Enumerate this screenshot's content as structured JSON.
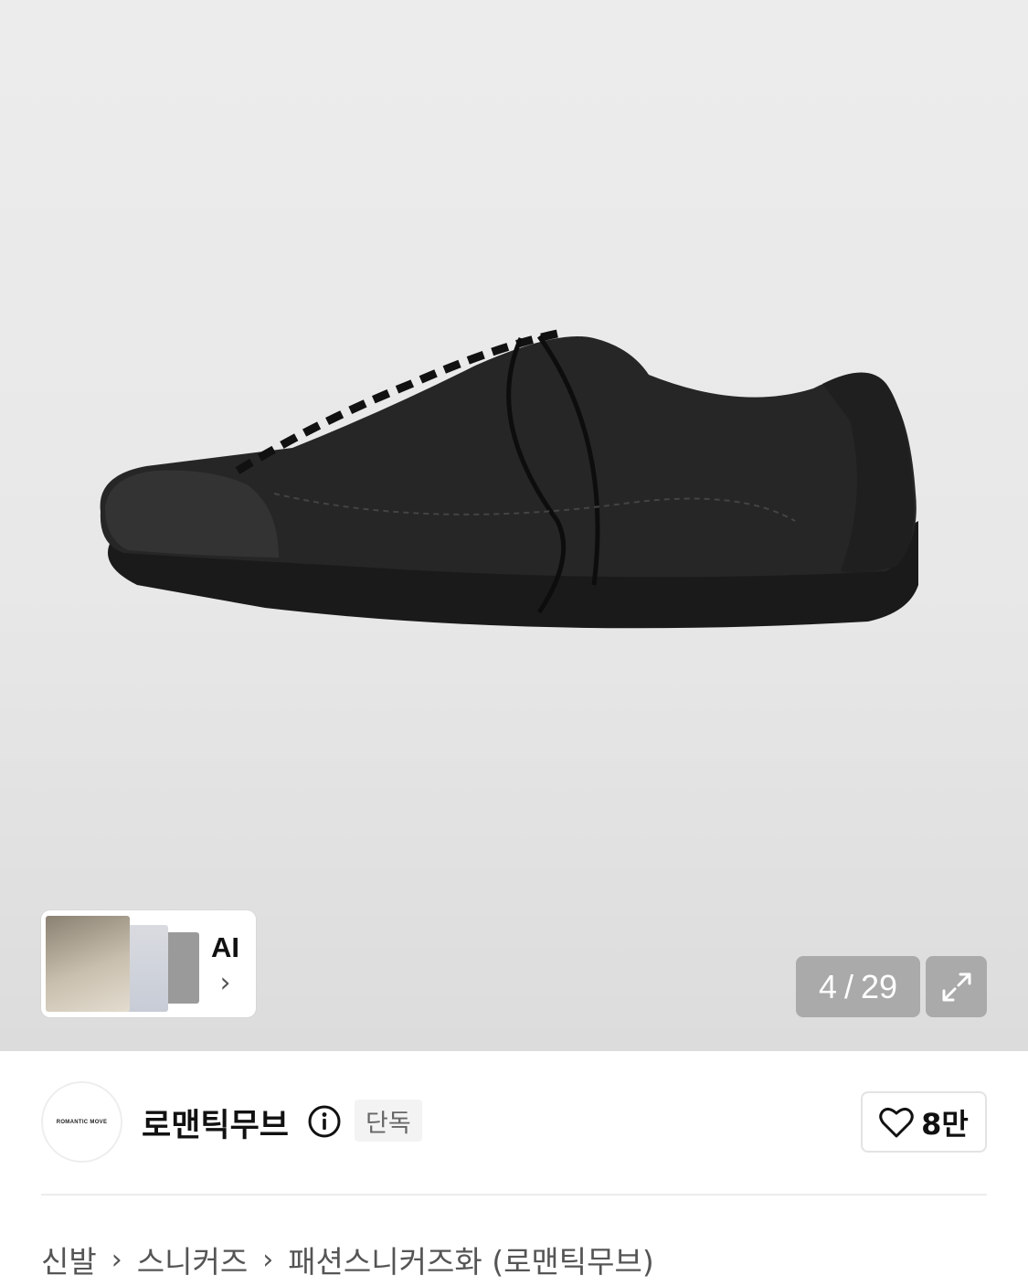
{
  "gallery": {
    "current": "4",
    "separator": "/",
    "total": "29",
    "ai_label": "AI",
    "ai_chevron": "›"
  },
  "brand": {
    "logo_text": "ROMANTIC MOVE",
    "name": "로맨틱무브",
    "badge": "단독",
    "likes": "8만"
  },
  "breadcrumb": {
    "items": [
      "신발",
      "스니커즈",
      "패션스니커즈화 (로맨틱무브)"
    ],
    "separator": "›"
  },
  "icons": {
    "info": "info-circle-icon",
    "heart": "heart-outline-icon",
    "expand": "expand-arrows-icon"
  },
  "colors": {
    "hero_bg": "#e8e8e8",
    "overlay_bg": "#969696",
    "badge_bg": "#f3f3f3"
  }
}
